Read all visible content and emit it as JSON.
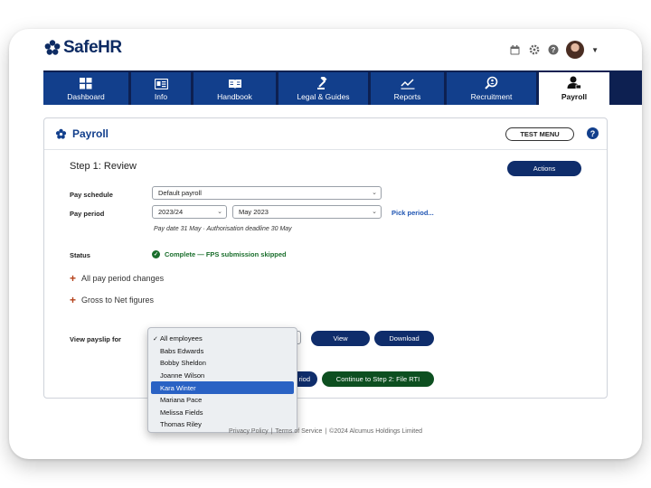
{
  "app": {
    "logo_text": "SafeHR",
    "brand_color": "#0d2b63",
    "accent_color": "#123f8c"
  },
  "top_icons": [
    "calendar-icon",
    "gear-icon",
    "help-icon",
    "avatar",
    "chevron-down-icon"
  ],
  "nav": {
    "tabs": [
      {
        "label": "Dashboard",
        "icon": "dashboard-icon",
        "active": false
      },
      {
        "label": "Info",
        "icon": "info-icon",
        "active": false
      },
      {
        "label": "Handbook",
        "icon": "book-icon",
        "active": false
      },
      {
        "label": "Legal & Guides",
        "icon": "gavel-icon",
        "active": false
      },
      {
        "label": "Reports",
        "icon": "chart-icon",
        "active": false
      },
      {
        "label": "Recruitment",
        "icon": "search-icon",
        "active": false
      },
      {
        "label": "Payroll",
        "icon": "person-icon",
        "active": true
      }
    ]
  },
  "panel": {
    "title": "Payroll",
    "test_menu_label": "TEST MENU",
    "help_symbol": "?",
    "step_title": "Step 1: Review",
    "actions_label": "Actions",
    "pay_schedule_label": "Pay schedule",
    "pay_schedule_value": "Default payroll",
    "pay_period_label": "Pay period",
    "pay_year_value": "2023/24",
    "pay_month_value": "May 2023",
    "pick_period_label": "Pick period...",
    "pay_dates_text": "Pay date 31 May  ·  Authorisation deadline 30 May",
    "status_label": "Status",
    "status_text": "Complete — FPS submission skipped",
    "expander_1": "All pay period changes",
    "expander_2": "Gross to Net figures",
    "view_payslip_label": "View payslip for",
    "view_label": "View",
    "download_label": "Download",
    "back_period_partial": "riod",
    "continue_label": "Continue to Step 2: File RTI"
  },
  "payslip_dropdown": {
    "selected": "All employees",
    "highlighted": "Kara Winter",
    "options": [
      "All employees",
      "Babs Edwards",
      "Bobby Sheldon",
      "Joanne Wilson",
      "Kara Winter",
      "Mariana Pace",
      "Melissa Fields",
      "Thomas Riley"
    ]
  },
  "footer": {
    "privacy": "Privacy Policy",
    "terms": "Terms of Service",
    "copyright": "©2024 Alcumus Holdings Limited"
  }
}
